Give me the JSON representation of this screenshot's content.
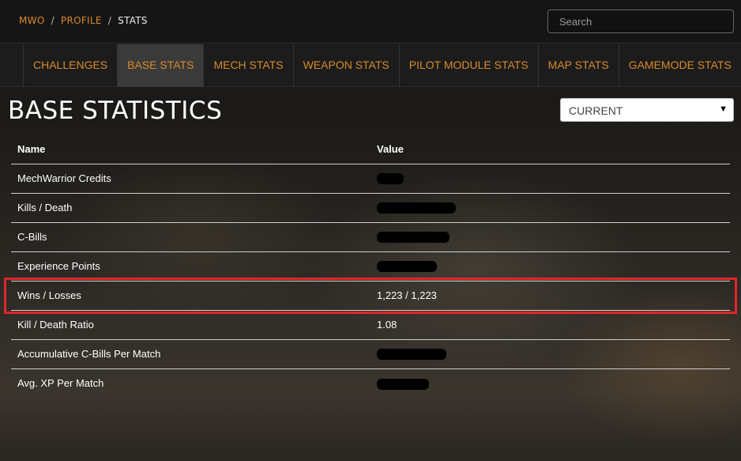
{
  "breadcrumb": {
    "items": [
      "MWO",
      "PROFILE"
    ],
    "current": "STATS"
  },
  "search": {
    "placeholder": "Search"
  },
  "tabs": [
    {
      "label": "CHALLENGES",
      "active": false
    },
    {
      "label": "BASE STATS",
      "active": true
    },
    {
      "label": "MECH STATS",
      "active": false
    },
    {
      "label": "WEAPON STATS",
      "active": false
    },
    {
      "label": "PILOT MODULE STATS",
      "active": false
    },
    {
      "label": "MAP STATS",
      "active": false
    },
    {
      "label": "GAMEMODE STATS",
      "active": false
    }
  ],
  "page": {
    "title": "BASE STATISTICS",
    "period_select": "CURRENT"
  },
  "table": {
    "headers": {
      "name": "Name",
      "value": "Value"
    },
    "rows": [
      {
        "name": "MechWarrior Credits",
        "value": "",
        "redacted": true
      },
      {
        "name": "Kills / Death",
        "value": "",
        "redacted": true
      },
      {
        "name": "C-Bills",
        "value": "",
        "redacted": true
      },
      {
        "name": "Experience Points",
        "value": "",
        "redacted": true
      },
      {
        "name": "Wins / Losses",
        "value": "1,223 / 1,223",
        "redacted": false,
        "highlighted": true
      },
      {
        "name": "Kill / Death Ratio",
        "value": "1.08",
        "redacted": false,
        "color": "#2eb82e"
      },
      {
        "name": "Accumulative C-Bills Per Match",
        "value": "",
        "redacted": true
      },
      {
        "name": "Avg. XP Per Match",
        "value": "",
        "redacted": true
      }
    ]
  },
  "colors": {
    "accent": "#d98a2b",
    "highlight_border": "#e0262b",
    "positive": "#2eb82e"
  }
}
